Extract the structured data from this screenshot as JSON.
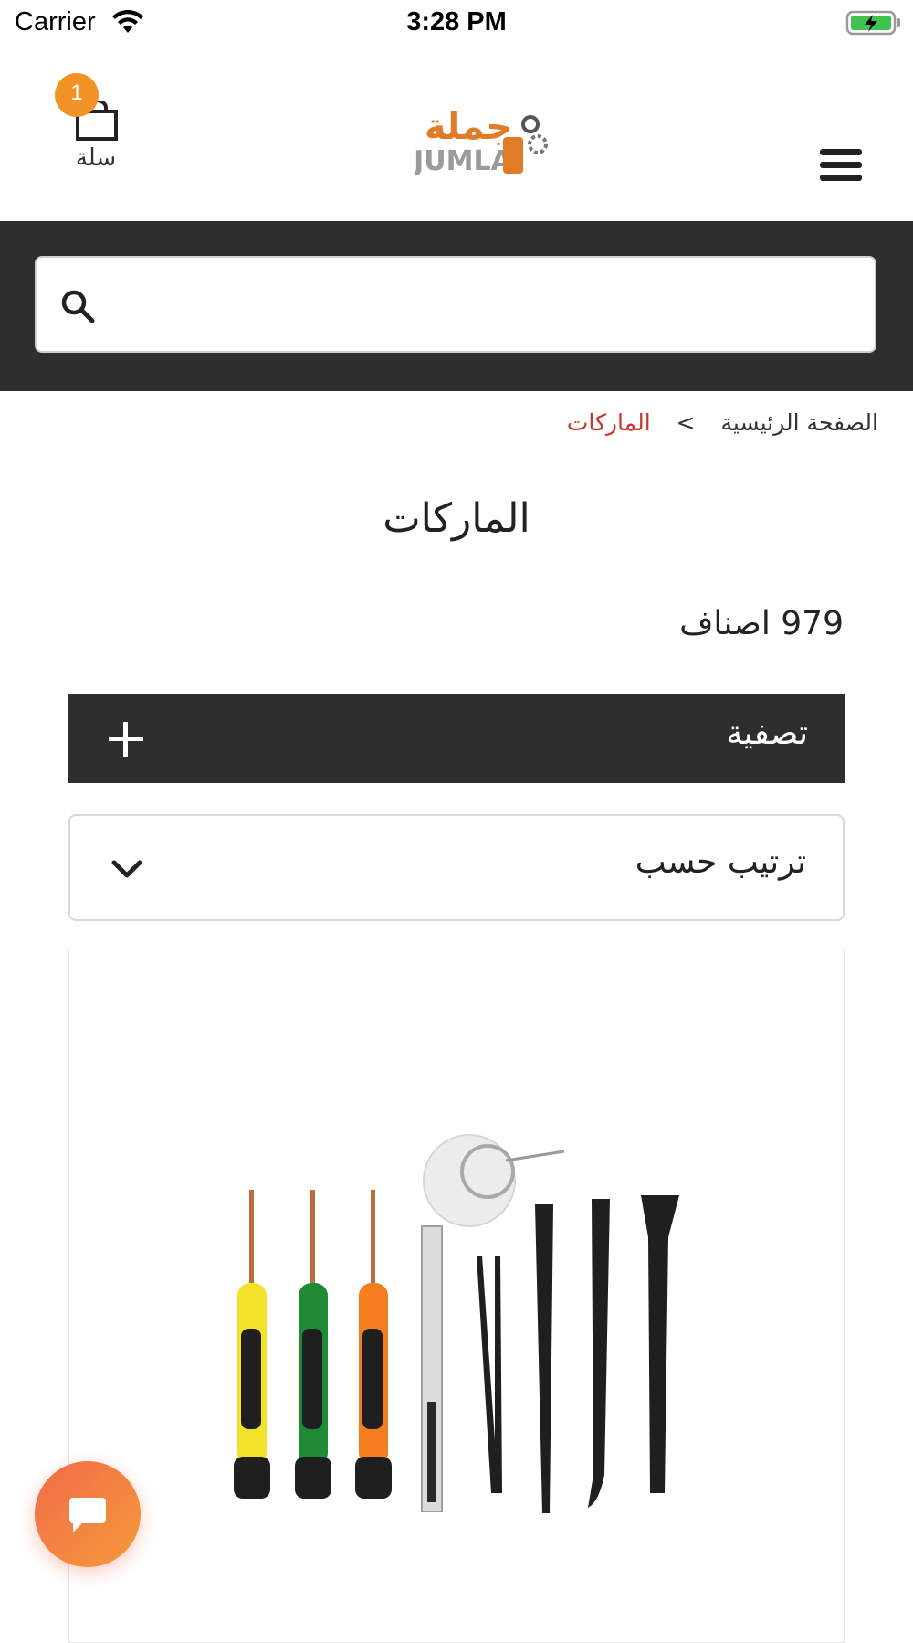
{
  "status_bar": {
    "carrier": "Carrier",
    "time": "3:28 PM",
    "wifi_icon": "wifi-icon",
    "battery_icon": "battery-charging-icon"
  },
  "header": {
    "cart_count": "1",
    "cart_label": "سلة",
    "cart_icon": "shopping-bag-icon",
    "logo_arabic": "جملة",
    "logo_latin": "JUMLA",
    "menu_icon": "hamburger-menu-icon",
    "brand_color": "#f39325"
  },
  "search": {
    "value": "",
    "icon": "search-icon"
  },
  "breadcrumb": {
    "home": "الصفحة الرئيسية",
    "separator": ">",
    "current": "الماركات",
    "current_color": "#c8342b"
  },
  "page": {
    "title": "الماركات",
    "item_count": "979 اصناف"
  },
  "filter": {
    "label": "تصفية",
    "icon": "plus-icon"
  },
  "sort": {
    "label": "ترتيب حسب",
    "icon": "chevron-down-icon"
  },
  "product": {
    "image_alt": "phone repair tool kit"
  },
  "chat": {
    "icon": "chat-bubble-icon",
    "color": "#f26b4a"
  }
}
